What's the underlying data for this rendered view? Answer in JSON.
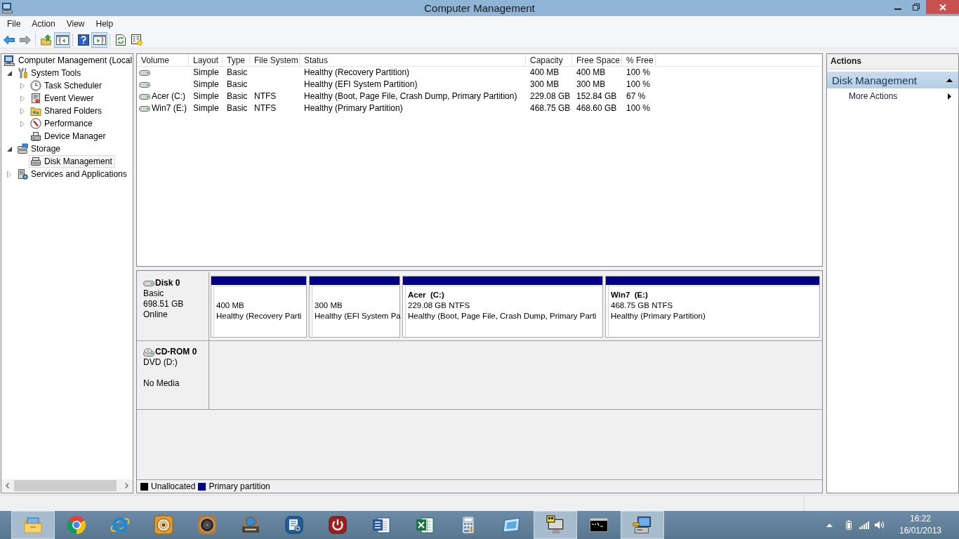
{
  "window": {
    "title": "Computer Management"
  },
  "menu": [
    "File",
    "Action",
    "View",
    "Help"
  ],
  "toolbar": [
    {
      "kind": "back",
      "disabled": false
    },
    {
      "kind": "forward",
      "disabled": true
    },
    {
      "kind": "separator"
    },
    {
      "kind": "up"
    },
    {
      "kind": "console-tree",
      "pressed": true
    },
    {
      "kind": "separator"
    },
    {
      "kind": "help"
    },
    {
      "kind": "action-pane",
      "pressed": true
    },
    {
      "kind": "separator"
    },
    {
      "kind": "refresh"
    },
    {
      "kind": "export"
    }
  ],
  "tree": {
    "items": [
      {
        "label": "Computer Management (Local",
        "kind": "computer",
        "selected": false,
        "children": [
          {
            "label": "System Tools",
            "kind": "tools",
            "expanded": true,
            "selected": false,
            "children": [
              {
                "label": "Task Scheduler",
                "kind": "clock",
                "expanded": false,
                "selected": false
              },
              {
                "label": "Event Viewer",
                "kind": "log",
                "expanded": false,
                "selected": false
              },
              {
                "label": "Shared Folders",
                "kind": "shared-folder",
                "expanded": false,
                "selected": false
              },
              {
                "label": "Performance",
                "kind": "gauge",
                "expanded": false,
                "selected": false
              },
              {
                "label": "Device Manager",
                "kind": "device",
                "selected": false
              }
            ]
          },
          {
            "label": "Storage",
            "kind": "storage",
            "expanded": true,
            "selected": false,
            "children": [
              {
                "label": "Disk Management",
                "kind": "drive",
                "selected": true
              }
            ]
          },
          {
            "label": "Services and Applications",
            "kind": "services",
            "expanded": false,
            "selected": false
          }
        ]
      }
    ]
  },
  "volumes": {
    "columns": [
      "Volume",
      "Layout",
      "Type",
      "File System",
      "Status",
      "Capacity",
      "Free Space",
      "% Free"
    ],
    "rows": [
      {
        "layout": "Simple",
        "type": "Basic",
        "status": "Healthy (Recovery Partition)",
        "capacity": "400 MB",
        "free_space": "400 MB",
        "percent_free": "100 %"
      },
      {
        "layout": "Simple",
        "type": "Basic",
        "status": "Healthy (EFI System Partition)",
        "capacity": "300 MB",
        "free_space": "300 MB",
        "percent_free": "100 %"
      },
      {
        "volume": "Acer (C:)",
        "layout": "Simple",
        "type": "Basic",
        "file_system": "NTFS",
        "status": "Healthy (Boot, Page File, Crash Dump, Primary Partition)",
        "capacity": "229.08 GB",
        "free_space": "152.84 GB",
        "percent_free": "67 %"
      },
      {
        "volume": "Win7 (E:)",
        "layout": "Simple",
        "type": "Basic",
        "file_system": "NTFS",
        "status": "Healthy (Primary Partition)",
        "capacity": "468.75 GB",
        "free_space": "468.60 GB",
        "percent_free": "100 %"
      }
    ]
  },
  "disks": [
    {
      "kind": "disk",
      "name": "Disk 0",
      "type": "Basic",
      "size": "698.51 GB",
      "status": "Online",
      "partitions": [
        {
          "kind": "primary",
          "size": "400 MB",
          "status": "Healthy (Recovery Parti"
        },
        {
          "kind": "primary",
          "size": "300 MB",
          "status": "Healthy (EFI System Pa"
        },
        {
          "kind": "primary",
          "name": "Acer  (C:)",
          "size": "229.08 GB NTFS",
          "status": "Healthy (Boot, Page File, Crash Dump, Primary Parti"
        },
        {
          "kind": "primary",
          "name": "Win7  (E:)",
          "size": "468.75 GB NTFS",
          "status": "Healthy (Primary Partition)"
        }
      ]
    },
    {
      "kind": "cdrom",
      "name": "CD-ROM 0",
      "type": "DVD (D:)",
      "status": "No Media"
    }
  ],
  "legend": [
    {
      "kind": "unallocated",
      "label": "Unallocated",
      "color": "#000000"
    },
    {
      "kind": "primary",
      "label": "Primary partition",
      "color": "#000080"
    }
  ],
  "actions": {
    "title": "Actions",
    "sections": [
      {
        "title": "Disk Management",
        "expanded": true,
        "items": [
          {
            "label": "More Actions",
            "submenu": true
          }
        ]
      }
    ]
  },
  "taskbar": {
    "apps": [
      {
        "kind": "explorer",
        "running": true
      },
      {
        "kind": "chrome",
        "running": false
      },
      {
        "kind": "ie",
        "running": false
      },
      {
        "kind": "disc",
        "running": false
      },
      {
        "kind": "speaker",
        "running": false
      },
      {
        "kind": "doc",
        "running": false
      },
      {
        "kind": "gear-doc",
        "running": false
      },
      {
        "kind": "power",
        "running": false
      },
      {
        "kind": "word",
        "running": false
      },
      {
        "kind": "excel",
        "running": false
      },
      {
        "kind": "calculator",
        "running": false
      },
      {
        "kind": "window",
        "running": false
      },
      {
        "kind": "monitor",
        "running": true
      },
      {
        "kind": "terminal",
        "running": false
      },
      {
        "kind": "computer-tools",
        "running": true
      }
    ],
    "clock": {
      "time": "16:22",
      "date": "16/01/2013"
    }
  }
}
